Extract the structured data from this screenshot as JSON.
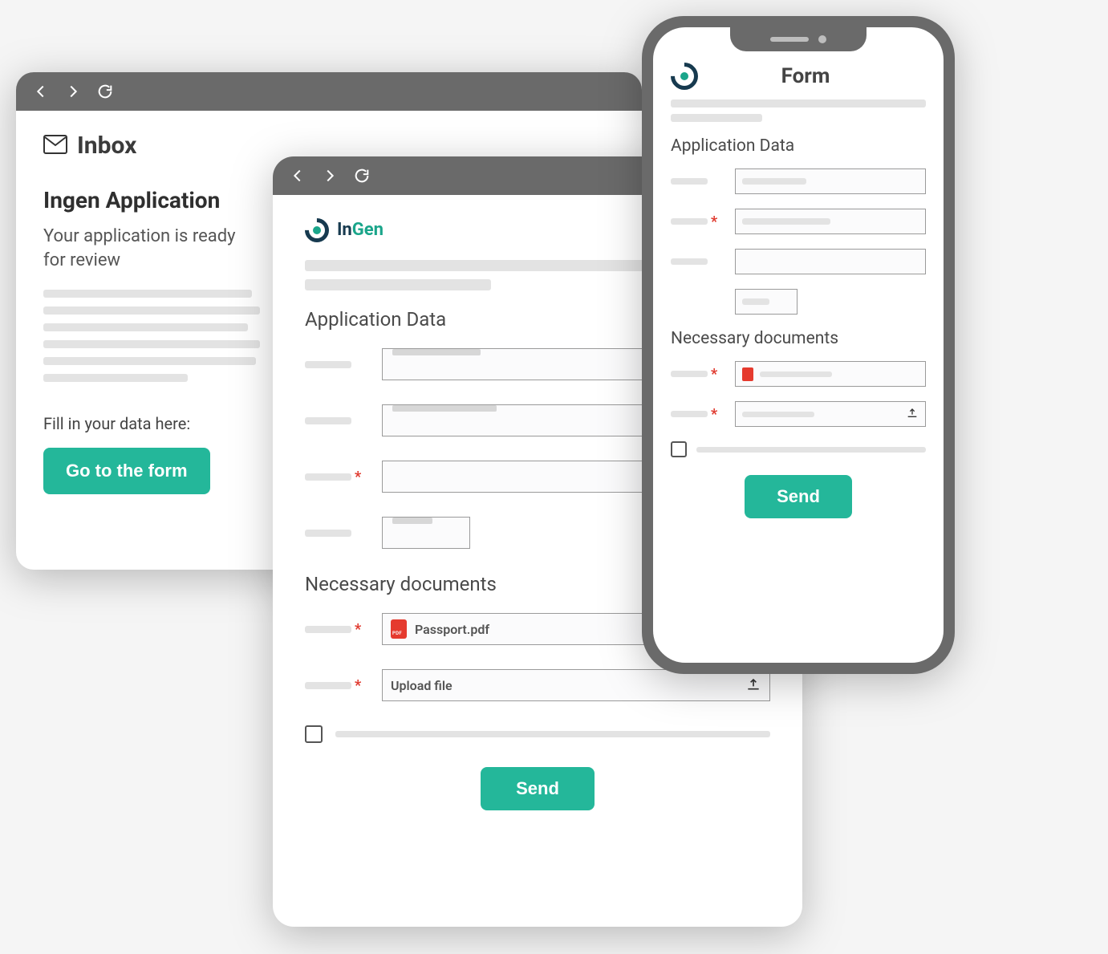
{
  "brand": {
    "name_part1": "In",
    "name_part2": "Gen"
  },
  "inbox": {
    "title": "Inbox",
    "subject": "Ingen Application",
    "preview": "Your application is ready for review",
    "cta_label": "Fill in your data here:",
    "button": "Go to the form"
  },
  "form": {
    "title": "Form",
    "section_app_data": "Application Data",
    "section_docs": "Necessary documents",
    "uploaded_file": "Passport.pdf",
    "upload_placeholder": "Upload file",
    "send": "Send"
  },
  "phone": {
    "title": "Form",
    "section_app_data": "Application Data",
    "section_docs": "Necessary documents",
    "send": "Send"
  },
  "colors": {
    "accent": "#24b79a",
    "required": "#e03a2f"
  }
}
